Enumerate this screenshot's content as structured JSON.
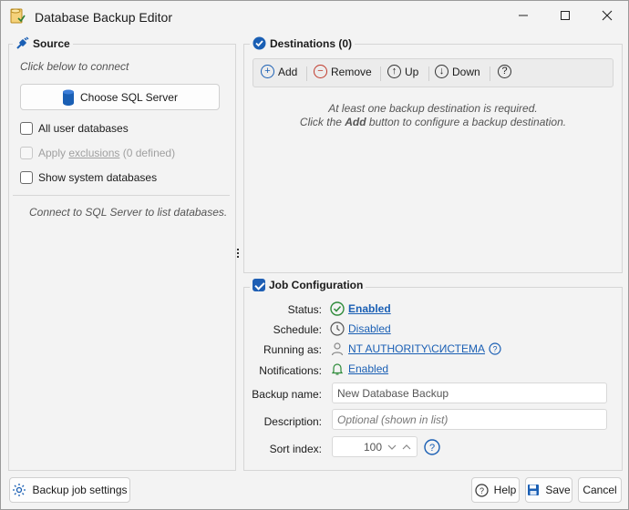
{
  "window": {
    "title": "Database Backup Editor"
  },
  "source": {
    "title": "Source",
    "hint": "Click below to connect",
    "choose_button": "Choose SQL Server",
    "all_user_databases": "All user databases",
    "apply_prefix": "Apply ",
    "exclusions_link": "exclusions",
    "exclusions_count": " (0 defined)",
    "show_system": "Show system databases",
    "connect_hint": "Connect to SQL Server to list databases."
  },
  "destinations": {
    "title": "Destinations (0)",
    "toolbar": {
      "add": "Add",
      "remove": "Remove",
      "up": "Up",
      "down": "Down"
    },
    "msg_line1": "At least one backup destination is required.",
    "msg_line2_prefix": "Click the ",
    "msg_line2_bold": "Add",
    "msg_line2_suffix": " button to configure a backup destination."
  },
  "job": {
    "title": "Job Configuration",
    "status_label": "Status:",
    "status_value": "Enabled",
    "schedule_label": "Schedule:",
    "schedule_value": "Disabled",
    "running_label": "Running as:",
    "running_value": "NT AUTHORITY\\СИСТЕМА",
    "notifications_label": "Notifications:",
    "notifications_value": "Enabled",
    "backup_name_label": "Backup name:",
    "backup_name_value": "New Database Backup",
    "description_label": "Description:",
    "description_placeholder": "Optional (shown in list)",
    "sort_label": "Sort index:",
    "sort_value": "100"
  },
  "footer": {
    "settings_button": "Backup job settings",
    "help_button": "Help",
    "save_button": "Save",
    "cancel_button": "Cancel"
  },
  "colors": {
    "accent": "#1a5fb4",
    "enabled_green": "#2e8b3a"
  }
}
